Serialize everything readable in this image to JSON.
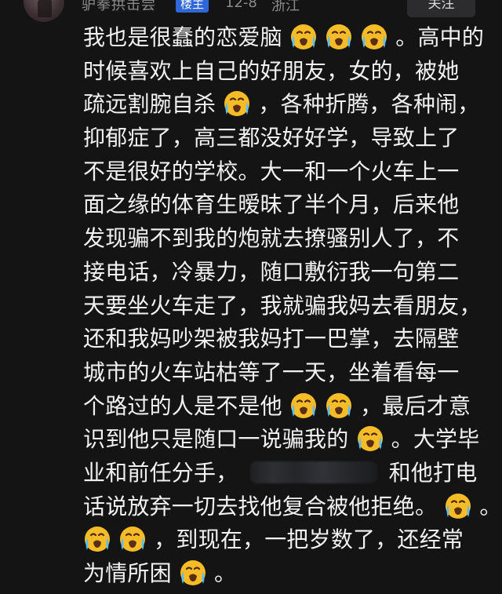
{
  "header": {
    "username": "驴拳拱击尝",
    "op_badge": "楼主",
    "date": "12-8",
    "region": "浙江",
    "follow_label": "关注"
  },
  "comment": {
    "line1": "我也是很蠢的恋爱脑",
    "line1b": "。高中的",
    "line2": "时候喜欢上自己的好朋友，女的，被她",
    "line3a": "疏远割腕自杀",
    "line3b": "，各种折腾，各种闹，",
    "line4": "抑郁症了，高三都没好好学，导致上了",
    "line5": "不是很好的学校。大一和一个火车上一",
    "line6": "面之缘的体育生暧昧了半个月，后来他",
    "line7": "发现骗不到我的炮就去撩骚别人了，不",
    "line8": "接电话，冷暴力，随口敷衍我一句第二",
    "line9": "天要坐火车走了，我就骗我妈去看朋友，",
    "line10": "还和我妈吵架被我妈打一巴掌，去隔壁",
    "line11": "城市的火车站枯等了一天，坐着看每一",
    "line12a": "个路过的人是不是他",
    "line12b": "，最后才意",
    "line13a": "识到他只是随口一说骗我的",
    "line13b": "。大学毕",
    "line14a": "业和前任分手，",
    "line14b": "和他打电",
    "line15a": "话说放弃一切去找他复合被他拒绝。",
    "line15b": "。",
    "line16": "，到现在，一把岁数了，还经常",
    "line17a": "为情所困",
    "line17b": "。"
  },
  "icons": {
    "emoji": "loudly-crying-face-emoji",
    "redaction": "blurred-redaction"
  },
  "colors": {
    "background": "#141414",
    "text": "#f1f1f1",
    "muted": "#8b8b8b",
    "badge": "#2f67d9",
    "emoji": "#f4b400"
  }
}
